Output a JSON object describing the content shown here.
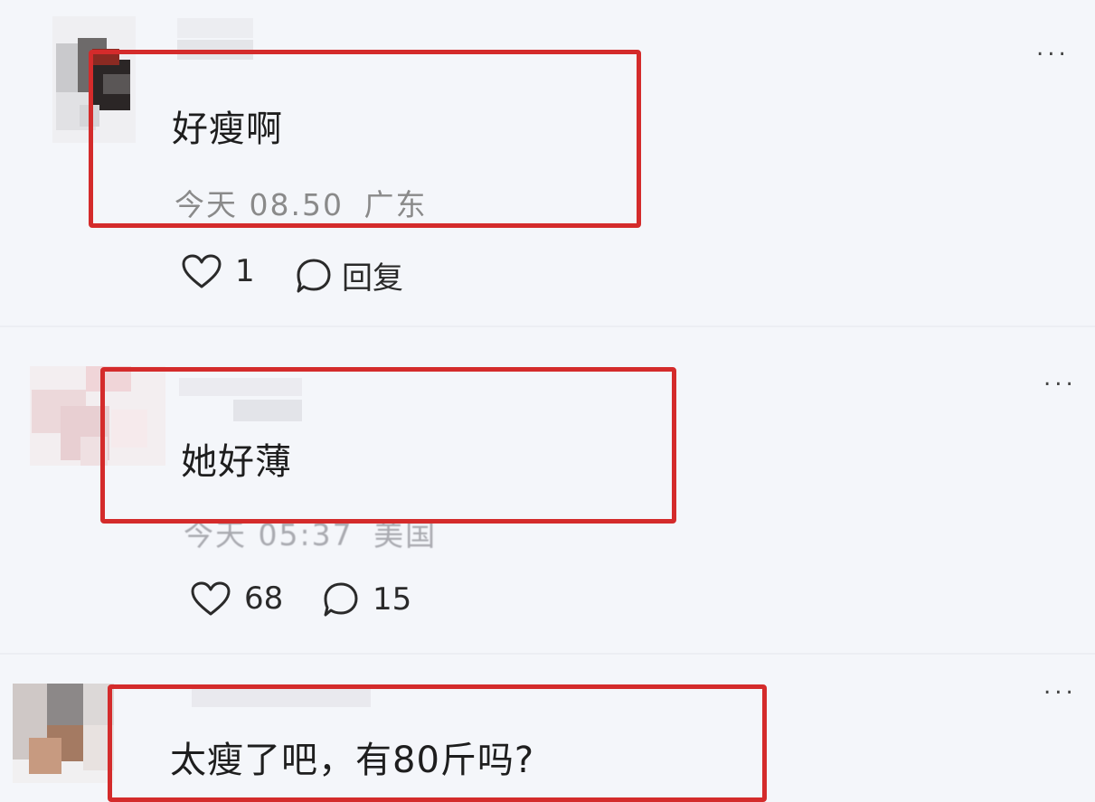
{
  "comments": [
    {
      "text": "好瘦啊",
      "time": "今天 08.50",
      "location": "广东",
      "likes": "1",
      "reply_label": "回复",
      "more": "..."
    },
    {
      "text": "她好薄",
      "time": "今天 05:37",
      "location": "美国",
      "likes": "68",
      "replies": "15",
      "more": "..."
    },
    {
      "text": "太瘦了吧，有80斤吗?",
      "more": "..."
    }
  ],
  "colors": {
    "highlight": "#d42b2b",
    "background": "#f4f6fa"
  },
  "icons": {
    "like": "heart-outline-icon",
    "reply": "chat-bubble-icon",
    "more": "more-dots-icon"
  }
}
